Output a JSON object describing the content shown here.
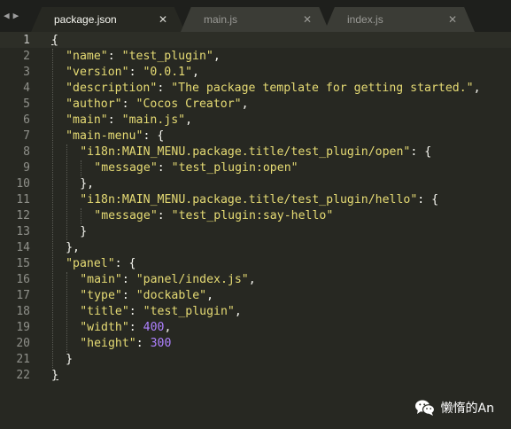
{
  "tabs": [
    {
      "label": "package.json",
      "active": true
    },
    {
      "label": "main.js",
      "active": false
    },
    {
      "label": "index.js",
      "active": false
    }
  ],
  "nav": {
    "back_glyph": "◀",
    "forward_glyph": "▶",
    "close_glyph": "✕"
  },
  "colors": {
    "background": "#272822",
    "tabbar": "#1e1f1c",
    "string": "#e6db74",
    "number": "#ae81ff",
    "text": "#f8f8f2",
    "line_number": "#8f908a"
  },
  "editor": {
    "current_line": 1,
    "lines": [
      {
        "n": "1",
        "indent": 0,
        "parts": [
          {
            "t": "{",
            "c": "pun"
          }
        ]
      },
      {
        "n": "2",
        "indent": 1,
        "parts": [
          {
            "t": "\"name\"",
            "c": "key"
          },
          {
            "t": ": ",
            "c": "pun"
          },
          {
            "t": "\"test_plugin\"",
            "c": "str"
          },
          {
            "t": ",",
            "c": "pun"
          }
        ]
      },
      {
        "n": "3",
        "indent": 1,
        "parts": [
          {
            "t": "\"version\"",
            "c": "key"
          },
          {
            "t": ": ",
            "c": "pun"
          },
          {
            "t": "\"0.0.1\"",
            "c": "str"
          },
          {
            "t": ",",
            "c": "pun"
          }
        ]
      },
      {
        "n": "4",
        "indent": 1,
        "parts": [
          {
            "t": "\"description\"",
            "c": "key"
          },
          {
            "t": ": ",
            "c": "pun"
          },
          {
            "t": "\"The package template for getting started.\"",
            "c": "str"
          },
          {
            "t": ",",
            "c": "pun"
          }
        ]
      },
      {
        "n": "5",
        "indent": 1,
        "parts": [
          {
            "t": "\"author\"",
            "c": "key"
          },
          {
            "t": ": ",
            "c": "pun"
          },
          {
            "t": "\"Cocos Creator\"",
            "c": "str"
          },
          {
            "t": ",",
            "c": "pun"
          }
        ]
      },
      {
        "n": "6",
        "indent": 1,
        "parts": [
          {
            "t": "\"main\"",
            "c": "key"
          },
          {
            "t": ": ",
            "c": "pun"
          },
          {
            "t": "\"main.js\"",
            "c": "str"
          },
          {
            "t": ",",
            "c": "pun"
          }
        ]
      },
      {
        "n": "7",
        "indent": 1,
        "parts": [
          {
            "t": "\"main-menu\"",
            "c": "key"
          },
          {
            "t": ": {",
            "c": "pun"
          }
        ]
      },
      {
        "n": "8",
        "indent": 2,
        "parts": [
          {
            "t": "\"i18n:MAIN_MENU.package.title/test_plugin/open\"",
            "c": "key"
          },
          {
            "t": ": {",
            "c": "pun"
          }
        ]
      },
      {
        "n": "9",
        "indent": 3,
        "parts": [
          {
            "t": "\"message\"",
            "c": "key"
          },
          {
            "t": ": ",
            "c": "pun"
          },
          {
            "t": "\"test_plugin:open\"",
            "c": "str"
          }
        ]
      },
      {
        "n": "10",
        "indent": 2,
        "parts": [
          {
            "t": "},",
            "c": "pun"
          }
        ]
      },
      {
        "n": "11",
        "indent": 2,
        "parts": [
          {
            "t": "\"i18n:MAIN_MENU.package.title/test_plugin/hello\"",
            "c": "key"
          },
          {
            "t": ": {",
            "c": "pun"
          }
        ]
      },
      {
        "n": "12",
        "indent": 3,
        "parts": [
          {
            "t": "\"message\"",
            "c": "key"
          },
          {
            "t": ": ",
            "c": "pun"
          },
          {
            "t": "\"test_plugin:say-hello\"",
            "c": "str"
          }
        ]
      },
      {
        "n": "13",
        "indent": 2,
        "parts": [
          {
            "t": "}",
            "c": "pun"
          }
        ]
      },
      {
        "n": "14",
        "indent": 1,
        "parts": [
          {
            "t": "},",
            "c": "pun"
          }
        ]
      },
      {
        "n": "15",
        "indent": 1,
        "parts": [
          {
            "t": "\"panel\"",
            "c": "key"
          },
          {
            "t": ": {",
            "c": "pun"
          }
        ]
      },
      {
        "n": "16",
        "indent": 2,
        "parts": [
          {
            "t": "\"main\"",
            "c": "key"
          },
          {
            "t": ": ",
            "c": "pun"
          },
          {
            "t": "\"panel/index.js\"",
            "c": "str"
          },
          {
            "t": ",",
            "c": "pun"
          }
        ]
      },
      {
        "n": "17",
        "indent": 2,
        "parts": [
          {
            "t": "\"type\"",
            "c": "key"
          },
          {
            "t": ": ",
            "c": "pun"
          },
          {
            "t": "\"dockable\"",
            "c": "str"
          },
          {
            "t": ",",
            "c": "pun"
          }
        ]
      },
      {
        "n": "18",
        "indent": 2,
        "parts": [
          {
            "t": "\"title\"",
            "c": "key"
          },
          {
            "t": ": ",
            "c": "pun"
          },
          {
            "t": "\"test_plugin\"",
            "c": "str"
          },
          {
            "t": ",",
            "c": "pun"
          }
        ]
      },
      {
        "n": "19",
        "indent": 2,
        "parts": [
          {
            "t": "\"width\"",
            "c": "key"
          },
          {
            "t": ": ",
            "c": "pun"
          },
          {
            "t": "400",
            "c": "num"
          },
          {
            "t": ",",
            "c": "pun"
          }
        ]
      },
      {
        "n": "20",
        "indent": 2,
        "parts": [
          {
            "t": "\"height\"",
            "c": "key"
          },
          {
            "t": ": ",
            "c": "pun"
          },
          {
            "t": "300",
            "c": "num"
          }
        ]
      },
      {
        "n": "21",
        "indent": 1,
        "parts": [
          {
            "t": "}",
            "c": "pun"
          }
        ]
      },
      {
        "n": "22",
        "indent": 0,
        "parts": [
          {
            "t": "}",
            "c": "pun"
          }
        ]
      }
    ]
  },
  "watermark": {
    "icon": "wechat-icon",
    "text": "懒惰的An"
  }
}
